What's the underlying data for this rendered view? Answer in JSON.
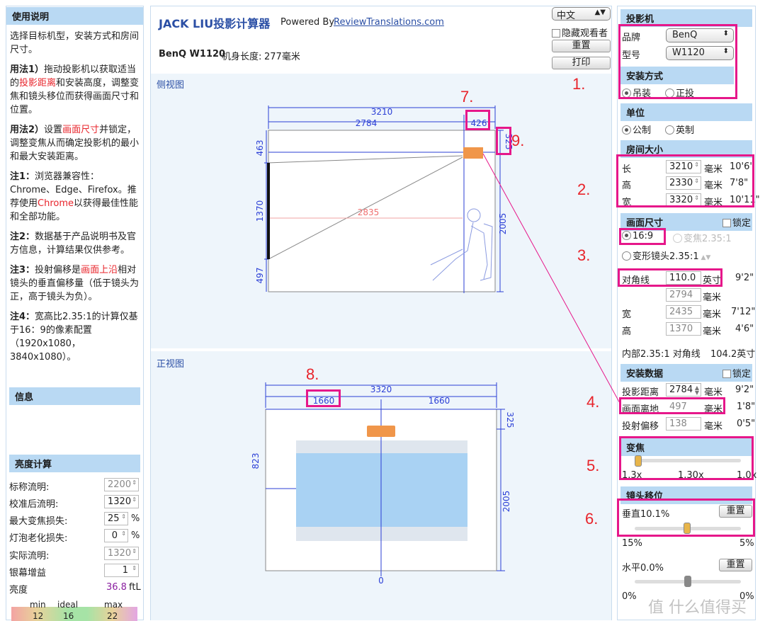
{
  "left": {
    "usage_title": "使用说明",
    "intro": "选择目标机型，安装方式和房间尺寸。",
    "u1a": "用法1）",
    "u1b": "拖动投影机以获取适当",
    "u1c": "的",
    "u1d": "投影距离",
    "u1e": "和安装高度，调整变",
    "u1f": "焦和镜头移位而获得画面尺寸和",
    "u1g": "位置。",
    "u2a": "用法2）",
    "u2b": "设置",
    "u2c": "画面尺寸",
    "u2d": "并锁定，",
    "u2e": "调整变焦从而确定投影机的最小",
    "u2f": "和最大安装距离。",
    "n1a": "注1：",
    "n1b": "浏览器兼容性：",
    "n1c": "Chrome、Edge、Firefox。推",
    "n1d": "荐使用",
    "n1e": "Chrome",
    "n1f": "以获得最佳性能",
    "n1g": "和全部功能。",
    "n2a": "注2：",
    "n2b": "数据基于产品说明书及官",
    "n2c": "方信息，计算结果仅供参考。",
    "n3a": "注3：",
    "n3b": "投射偏移是",
    "n3c": "画面上沿",
    "n3d": "相对",
    "n3e": "镜头的垂直偏移量（低于镜头为",
    "n3f": "正，高于镜头为负）。",
    "n4a": "注4：",
    "n4b": "宽高比2.35:1的计算仅基",
    "n4c": "于16：9的像素配置",
    "n4d": "（1920x1080，",
    "n4e": "3840x1080）。",
    "info_title": "信息",
    "bright_title": "亮度计算",
    "rows": [
      {
        "label": "标称流明:",
        "value": "2200",
        "disabled": true
      },
      {
        "label": "校准后流明:",
        "value": "1320",
        "disabled": false
      },
      {
        "label": "最大变焦损失:",
        "value": "25",
        "unit": "%",
        "disabled": false
      },
      {
        "label": "灯泡老化损失:",
        "value": "0",
        "unit": "%",
        "disabled": false
      },
      {
        "label": "实际流明:",
        "value": "1320",
        "disabled": true
      },
      {
        "label": "银幕增益",
        "value": "1",
        "disabled": false
      }
    ],
    "brightness_label": "亮度",
    "brightness_value": "36.8",
    "brightness_unit": "ftL",
    "scale": {
      "min_label": "min",
      "ideal_label": "ideal",
      "max_label": "max",
      "min": "12",
      "ideal": "16",
      "max": "22"
    }
  },
  "center": {
    "title": "JACK LIU投影计算器",
    "powered": "Powered By",
    "powered_link": "ReviewTranslations.com",
    "model_name": "BenQ W1120",
    "model_len_label": "机身长度:",
    "model_len": "277毫米",
    "lang": "中文",
    "hide_viewer": "隐藏观看者",
    "reset": "重置",
    "print": "打印",
    "side_title": "侧视图",
    "front_title": "正视图",
    "side": {
      "total": "3210",
      "left": "2784",
      "proj": "426",
      "top": "463",
      "mid": "1370",
      "bottom": "497",
      "right_top": "325",
      "right": "2005",
      "diag": "2835"
    },
    "front": {
      "total": "3320",
      "left": "1660",
      "right": "1660",
      "top": "325",
      "height": "823",
      "right_h": "2005",
      "zero": "0"
    }
  },
  "right": {
    "projector": "投影机",
    "brand_label": "品牌",
    "brand": "BenQ",
    "model_label": "型号",
    "model": "W1120",
    "mount": "安装方式",
    "mount_ceiling": "吊装",
    "mount_floor": "正投",
    "unit": "单位",
    "unit_metric": "公制",
    "unit_imperial": "英制",
    "room": "房间大小",
    "room_rows": [
      {
        "label": "长",
        "value": "3210",
        "unit": "毫米",
        "imp": "10'6\""
      },
      {
        "label": "高",
        "value": "2330",
        "unit": "毫米",
        "imp": "7'8\""
      },
      {
        "label": "宽",
        "value": "3320",
        "unit": "毫米",
        "imp": "10'11\""
      }
    ],
    "screen": "画面尺寸",
    "lock": "锁定",
    "ar169": "16:9",
    "ar235": "变焦2.35:1",
    "anam": "变形镜头2.35:1",
    "diag_label": "对角线",
    "diag_value": "110.0",
    "diag_unit": "英寸",
    "diag_imp": "9'2\"",
    "diag_mm": "2794",
    "mm": "毫米",
    "w_label": "宽",
    "w_value": "2435",
    "w_imp": "7'12\"",
    "h_label": "高",
    "h_value": "1370",
    "h_imp": "4'6\"",
    "inner_label": "内部2.35:1 对角线",
    "inner_value": "104.2英寸",
    "install": "安装数据",
    "throw_label": "投影距离",
    "throw_value": "2784",
    "throw_imp": "9'2\"",
    "floor_label": "画面离地",
    "floor_value": "497",
    "floor_imp": "1'8\"",
    "offset_label": "投射偏移",
    "offset_value": "138",
    "offset_imp": "0'5\"",
    "zoom": "变焦",
    "zoom_min": "1.3x",
    "zoom_cur": "1.30x",
    "zoom_max": "1.0x",
    "zoom_level": 0.0,
    "shift": "镜头移位",
    "vshift": "垂直10.1%",
    "vshift_reset": "重置",
    "vshift_min": "15%",
    "vshift_max": "5%",
    "vshift_level": 0.49,
    "hshift": "水平0.0%",
    "hshift_reset": "重置",
    "hshift_min": "0%",
    "hshift_max": "0%",
    "hshift_level": 0.5
  },
  "annotations": [
    "1.",
    "2.",
    "3.",
    "4.",
    "5.",
    "6.",
    "7.",
    "8.",
    "9."
  ],
  "watermark": "值 什么值得买",
  "colors": {
    "header": "#b9d9f3",
    "accent": "#e6178a",
    "projector": "#f0964a",
    "dim": "#2b3fd6",
    "screen": "#a9d2f3"
  }
}
